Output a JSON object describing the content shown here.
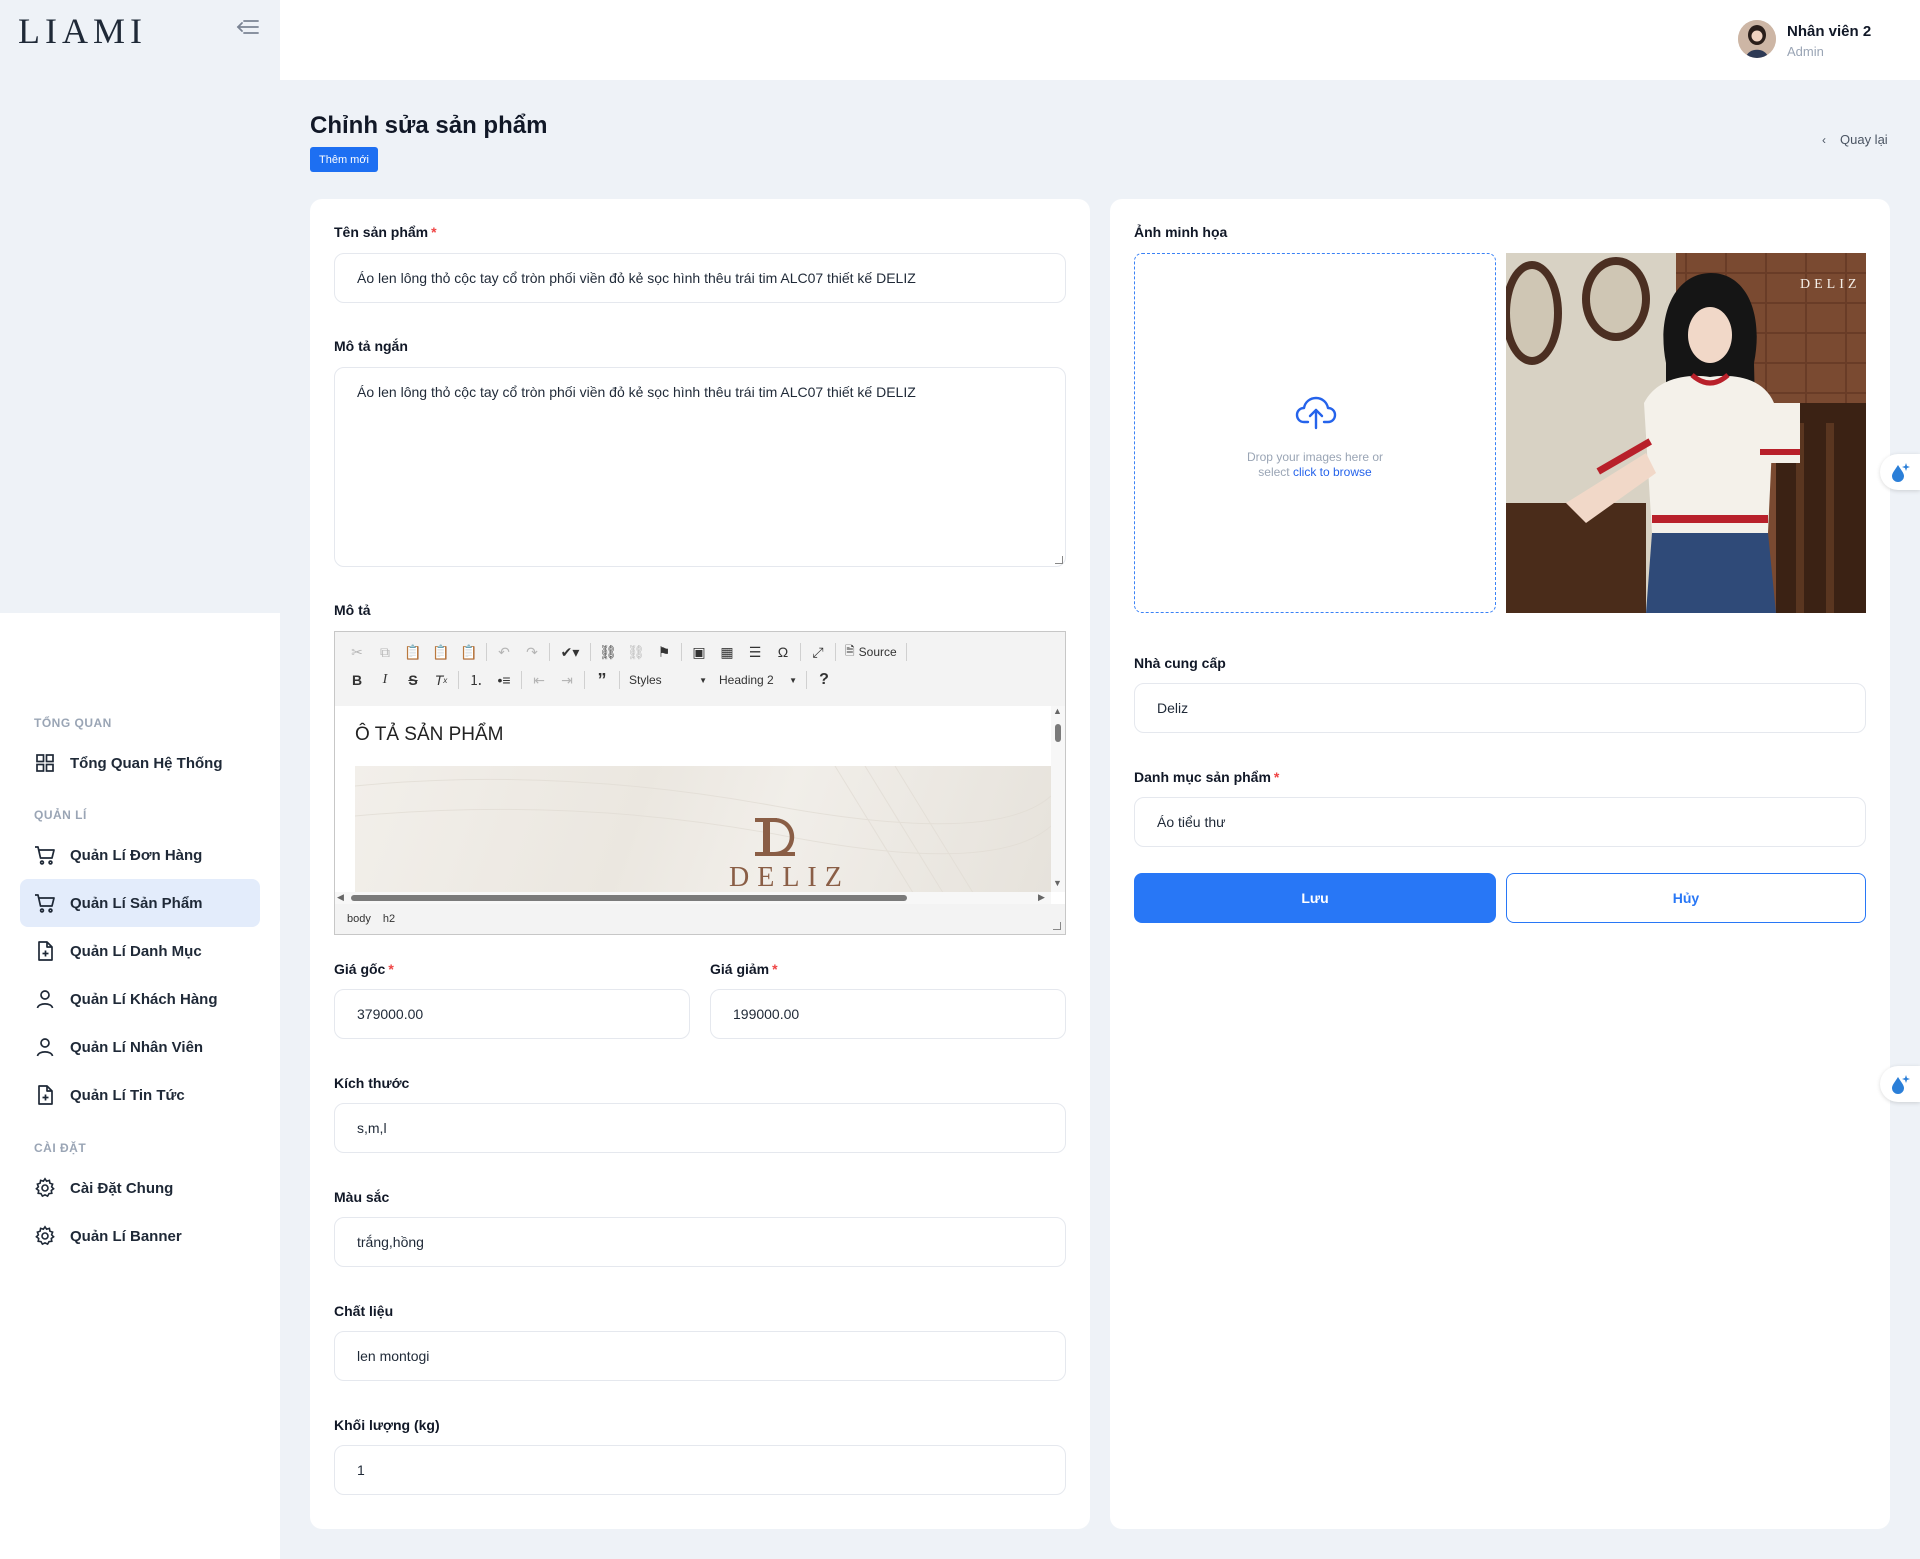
{
  "brand": {
    "logo_text": "LIAMI"
  },
  "header": {
    "user_name": "Nhân viên 2",
    "user_role": "Admin"
  },
  "sidebar": {
    "sections": [
      {
        "title": "TỔNG QUAN",
        "items": [
          {
            "label": "Tổng Quan Hệ Thống",
            "icon": "grid-icon"
          }
        ]
      },
      {
        "title": "QUẢN LÍ",
        "items": [
          {
            "label": "Quản Lí Đơn Hàng",
            "icon": "cart-icon"
          },
          {
            "label": "Quản Lí Sản Phẩm",
            "icon": "cart-icon",
            "active": true
          },
          {
            "label": "Quản Lí Danh Mục",
            "icon": "file-plus-icon"
          },
          {
            "label": "Quản Lí Khách Hàng",
            "icon": "user-icon"
          },
          {
            "label": "Quản Lí Nhân Viên",
            "icon": "user-icon"
          },
          {
            "label": "Quản Lí Tin Tức",
            "icon": "file-plus-icon"
          }
        ]
      },
      {
        "title": "CÀI ĐẶT",
        "items": [
          {
            "label": "Cài Đặt Chung",
            "icon": "gear-icon"
          },
          {
            "label": "Quản Lí Banner",
            "icon": "gear-icon"
          }
        ]
      }
    ]
  },
  "page": {
    "title": "Chỉnh sửa sản phẩm",
    "add_new": "Thêm mới",
    "back": "Quay lại"
  },
  "form": {
    "name_label": "Tên sản phẩm",
    "name_value": "Áo len lông thỏ cộc tay cổ tròn phối viền đỏ kẻ sọc hình thêu trái tim ALC07 thiết kế DELIZ",
    "short_desc_label": "Mô tả ngắn",
    "short_desc_value": "Áo len lông thỏ cộc tay cổ tròn phối viền đỏ kẻ sọc hình thêu trái tim ALC07 thiết kế DELIZ",
    "desc_label": "Mô tả",
    "editor": {
      "styles_combo": "Styles",
      "format_combo": "Heading 2",
      "source_label": "Source",
      "help": "?",
      "content_heading": "Ô TẢ SẢN PHẨM",
      "image_brand_text": "DELIZ",
      "path": [
        "body",
        "h2"
      ]
    },
    "price_label": "Giá gốc",
    "price_value": "379000.00",
    "sale_label": "Giá giảm",
    "sale_value": "199000.00",
    "size_label": "Kích thước",
    "size_value": "s,m,l",
    "color_label": "Màu sắc",
    "color_value": "trắng,hồng",
    "material_label": "Chất liệu",
    "material_value": "len montogi",
    "weight_label": "Khối lượng (kg)",
    "weight_value": "1",
    "image_label": "Ảnh minh họa",
    "drop_text_1": "Drop your images here or",
    "drop_text_2": "select",
    "drop_link": "click to browse",
    "preview_watermark": "DELIZ",
    "supplier_label": "Nhà cung cấp",
    "supplier_value": "Deliz",
    "category_label": "Danh mục sản phẩm",
    "category_value": "Áo tiểu thư",
    "save": "Lưu",
    "cancel": "Hủy",
    "required_mark": "*"
  },
  "colors": {
    "accent": "#2877f6",
    "required": "#ef4444",
    "background": "#eef2f7"
  }
}
